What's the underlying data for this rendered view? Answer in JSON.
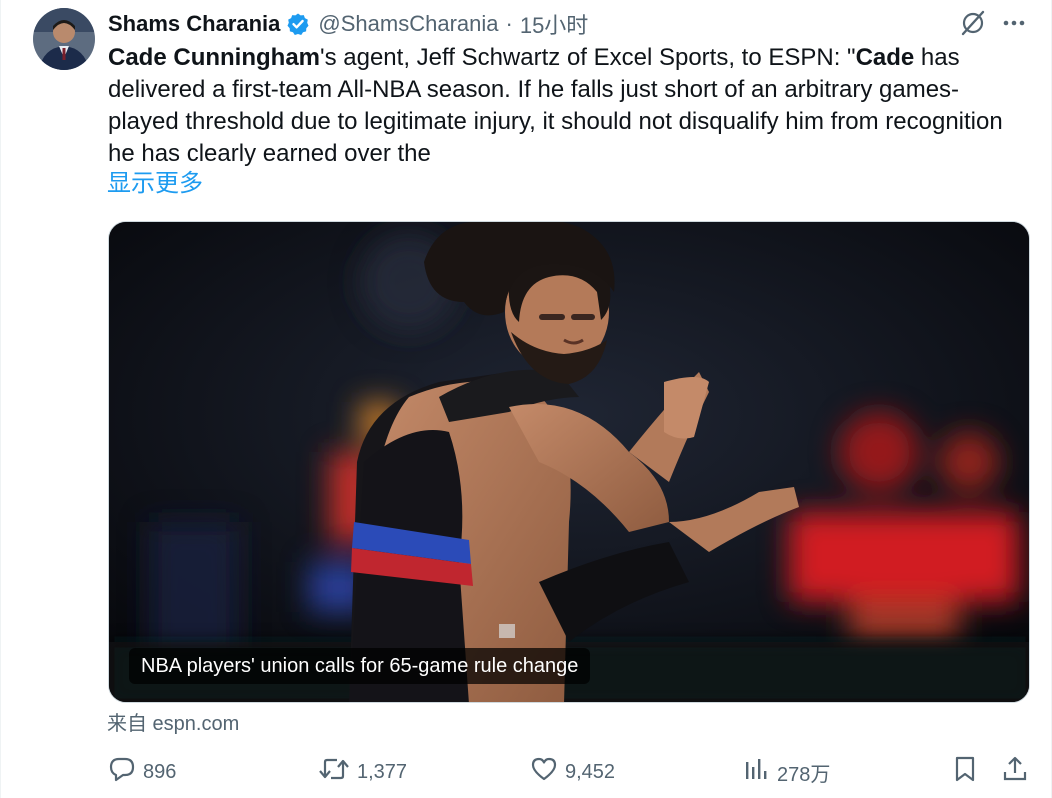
{
  "author": {
    "display_name": "Shams Charania",
    "handle": "@ShamsCharania",
    "separator": "·",
    "time": "15小时",
    "verified": true,
    "verified_color": "#1d9bf0"
  },
  "tweet": {
    "segments": [
      {
        "text": "Cade Cunningham",
        "bold": true
      },
      {
        "text": "'s agent, Jeff Schwartz of Excel Sports, to ESPN: \"",
        "bold": false
      },
      {
        "text": "Cade",
        "bold": true
      },
      {
        "text": " has delivered a first-team All-NBA season. If he falls just short of an arbitrary games-played threshold due to legitimate injury, it should not disqualify him from recognition he has clearly earned over the",
        "bold": false
      }
    ],
    "show_more_label": "显示更多"
  },
  "card": {
    "title": "NBA players' union calls for 65-game rule change",
    "source": "来自 espn.com"
  },
  "actions": {
    "reply_count": "896",
    "retweet_count": "1,377",
    "like_count": "9,452",
    "view_count": "278万"
  },
  "icons": {
    "reply": "reply-icon",
    "retweet": "retweet-icon",
    "like": "heart-icon",
    "views": "views-icon",
    "bookmark": "bookmark-icon",
    "share": "share-icon",
    "more": "more-icon",
    "grok": "grok-icon"
  },
  "colors": {
    "text": "#0f1419",
    "secondary": "#536471",
    "link": "#1d9bf0"
  }
}
